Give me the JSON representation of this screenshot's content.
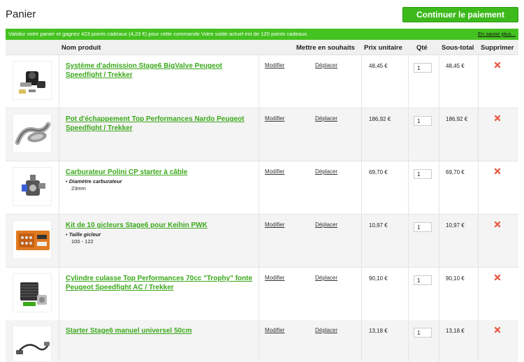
{
  "page": {
    "title": "Panier",
    "pay_button": "Continuer le paiement"
  },
  "banner": {
    "text": "Validez votre panier et gagnez 423 points cadeaux (4,23 €) pour cette commande Votre solde actuel est de 120 points cadeaux.",
    "link": "En savoir plus..."
  },
  "columns": {
    "product": "Nom produit",
    "wishlist": "Mettre en souhaits",
    "unit_price": "Prix unitaire",
    "qty": "Qté",
    "subtotal": "Sous-total",
    "delete": "Supprimer"
  },
  "actions": {
    "modify": "Modifier",
    "move": "Déplacer"
  },
  "colors": {
    "accent": "#3cba1c",
    "link": "#3aa81a",
    "delete": "#e8604a"
  },
  "items": [
    {
      "name": "Système d'admission Stage6 BigValve Peugeot Speedfight / Trekker",
      "price": "48,45 €",
      "qty": "1",
      "subtotal": "48,45 €",
      "option_label": "",
      "option_value": "",
      "image": "intake-system"
    },
    {
      "name": "Pot d'échappement Top Performances Nardo Peugeot Speedfight / Trekker",
      "price": "186,92 €",
      "qty": "1",
      "subtotal": "186,92 €",
      "option_label": "",
      "option_value": "",
      "image": "exhaust-pipe"
    },
    {
      "name": "Carburateur Polini CP starter à câble",
      "price": "69,70 €",
      "qty": "1",
      "subtotal": "69,70 €",
      "option_label": "Diamètre carburateur",
      "option_value": "23mm",
      "image": "carburetor"
    },
    {
      "name": "Kit de 10 gicleurs Stage6 pour Keihin PWK",
      "price": "10,97 €",
      "qty": "1",
      "subtotal": "10,97 €",
      "option_label": "Taille gicleur",
      "option_value": "100 - 122",
      "image": "jet-kit"
    },
    {
      "name": "Cylindre culasse Top Performances 70cc \"Trophy\" fonte Peugeot Speedfight AC / Trekker",
      "price": "90,10 €",
      "qty": "1",
      "subtotal": "90,10 €",
      "option_label": "",
      "option_value": "",
      "image": "cylinder-kit"
    },
    {
      "name": "Starter Stage6 manuel universel 50cm",
      "price": "13,18 €",
      "qty": "1",
      "subtotal": "13,18 €",
      "option_label": "",
      "option_value": "",
      "image": "starter-cable"
    }
  ]
}
